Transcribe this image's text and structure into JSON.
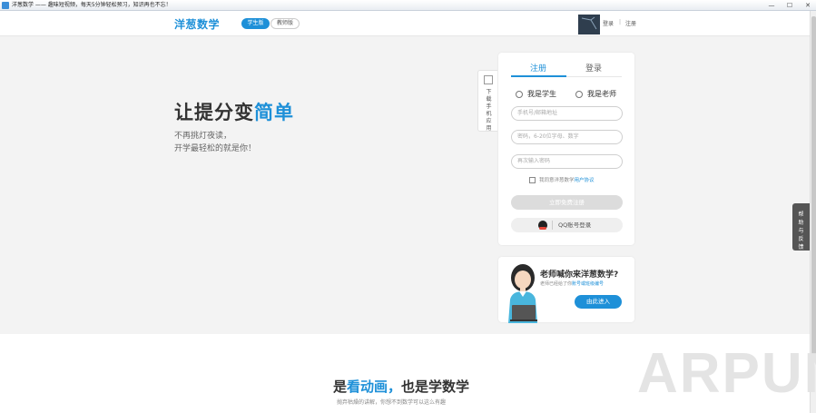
{
  "window": {
    "title": "洋葱数学 —— 趣味短视频，每天5分钟轻松预习，知识再也不忘！",
    "buttons": [
      "—",
      "☐",
      "✕"
    ]
  },
  "header": {
    "logo": "洋葱数学",
    "tab_student": "学生版",
    "tab_teacher": "教师版",
    "login": "登录",
    "separator": "|",
    "register": "注册"
  },
  "hero": {
    "title_main": "让提分变",
    "title_highlight": "简单",
    "subtitle_line1": "不再挑灯夜读，",
    "subtitle_line2": "开学最轻松的就是你！"
  },
  "download_side": {
    "label": "下载手机应用"
  },
  "register_panel": {
    "tab_register": "注册",
    "tab_login": "登录",
    "role_student": "我是学生",
    "role_teacher": "我是老师",
    "phone_placeholder": "手机号/邮箱地址",
    "password_placeholder": "密码，6-20位字母、数字",
    "confirm_placeholder": "再次输入密码",
    "agree_text": "我同意洋葱数学",
    "agree_link": "用户协议",
    "submit_label": "立即免费注册",
    "qq_label": "QQ账号登录"
  },
  "teacher_panel": {
    "title": "老师喊你来洋葱数学?",
    "sub_prefix": "老师已经给了你",
    "sub_link": "账号或班级编号",
    "enter_label": "由此进入"
  },
  "feedback": {
    "label": "帮助与反馈"
  },
  "bottom": {
    "title_pre": "是",
    "title_hl1": "看动画",
    "title_mid": "，也是学数学",
    "subtitle": "抛弃枯燥的讲解，你想不到数学可以这么有趣"
  },
  "watermark": "ARPUN"
}
